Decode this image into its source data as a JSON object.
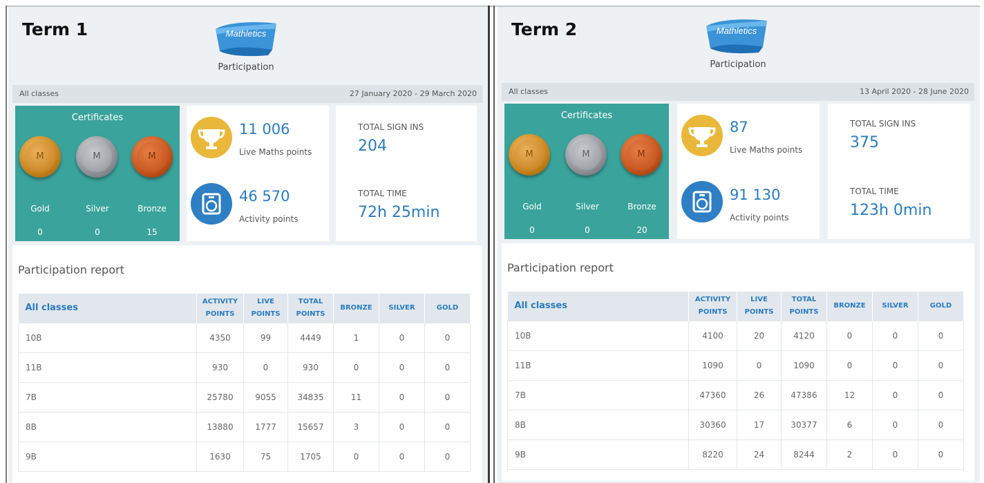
{
  "terms": [
    {
      "title": "Term 1",
      "logo_text": "Mathletics",
      "subtitle": "Participation",
      "filter": "All classes",
      "date_range": "27 January 2020 - 29 March 2020",
      "certificates": {
        "title": "Certificates",
        "medals": [
          {
            "label": "Gold",
            "count": "0",
            "letter": "M"
          },
          {
            "label": "Silver",
            "count": "0",
            "letter": "M"
          },
          {
            "label": "Bronze",
            "count": "15",
            "letter": "M"
          }
        ]
      },
      "live_points": {
        "value": "11 006",
        "label": "Live Maths points",
        "icon": "trophy-icon"
      },
      "activity_points": {
        "value": "46 570",
        "label": "Activity points",
        "icon": "activity-icon"
      },
      "total_sign_ins": {
        "label": "TOTAL SIGN INS",
        "value": "204"
      },
      "total_time": {
        "label": "TOTAL TIME",
        "value": "72h 25min"
      },
      "report": {
        "title": "Participation report",
        "headers": {
          "class": "All classes",
          "activity": [
            "ACTIVITY",
            "POINTS"
          ],
          "live": [
            "LIVE",
            "POINTS"
          ],
          "total": [
            "TOTAL",
            "POINTS"
          ],
          "bronze": "BRONZE",
          "silver": "SILVER",
          "gold": "GOLD"
        },
        "rows": [
          [
            "10B",
            "4350",
            "99",
            "4449",
            "1",
            "0",
            "0"
          ],
          [
            "11B",
            "930",
            "0",
            "930",
            "0",
            "0",
            "0"
          ],
          [
            "7B",
            "25780",
            "9055",
            "34835",
            "11",
            "0",
            "0"
          ],
          [
            "8B",
            "13880",
            "1777",
            "15657",
            "3",
            "0",
            "0"
          ],
          [
            "9B",
            "1630",
            "75",
            "1705",
            "0",
            "0",
            "0"
          ]
        ]
      }
    },
    {
      "title": "Term 2",
      "logo_text": "Mathletics",
      "subtitle": "Participation",
      "filter": "All classes",
      "date_range": "13 April 2020 - 28 June 2020",
      "certificates": {
        "title": "Certificates",
        "medals": [
          {
            "label": "Gold",
            "count": "0",
            "letter": "M"
          },
          {
            "label": "Silver",
            "count": "0",
            "letter": "M"
          },
          {
            "label": "Bronze",
            "count": "20",
            "letter": "M"
          }
        ]
      },
      "live_points": {
        "value": "87",
        "label": "Live Maths points",
        "icon": "trophy-icon"
      },
      "activity_points": {
        "value": "91 130",
        "label": "Activity points",
        "icon": "activity-icon"
      },
      "total_sign_ins": {
        "label": "TOTAL SIGN INS",
        "value": "375"
      },
      "total_time": {
        "label": "TOTAL TIME",
        "value": "123h 0min"
      },
      "report": {
        "title": "Participation report",
        "headers": {
          "class": "All classes",
          "activity": [
            "ACTIVITY",
            "POINTS"
          ],
          "live": [
            "LIVE",
            "POINTS"
          ],
          "total": [
            "TOTAL",
            "POINTS"
          ],
          "bronze": "BRONZE",
          "silver": "SILVER",
          "gold": "GOLD"
        },
        "rows": [
          [
            "10B",
            "4100",
            "20",
            "4120",
            "0",
            "0",
            "0"
          ],
          [
            "11B",
            "1090",
            "0",
            "1090",
            "0",
            "0",
            "0"
          ],
          [
            "7B",
            "47360",
            "26",
            "47386",
            "12",
            "0",
            "0"
          ],
          [
            "8B",
            "30360",
            "17",
            "30377",
            "6",
            "0",
            "0"
          ],
          [
            "9B",
            "8220",
            "24",
            "8244",
            "2",
            "0",
            "0"
          ]
        ]
      }
    }
  ],
  "colors": {
    "teal": "#3aa39c",
    "blue": "#2b7bc0",
    "trophy_gold": "#e9b83a",
    "activity_blue": "#2e7fc4"
  }
}
